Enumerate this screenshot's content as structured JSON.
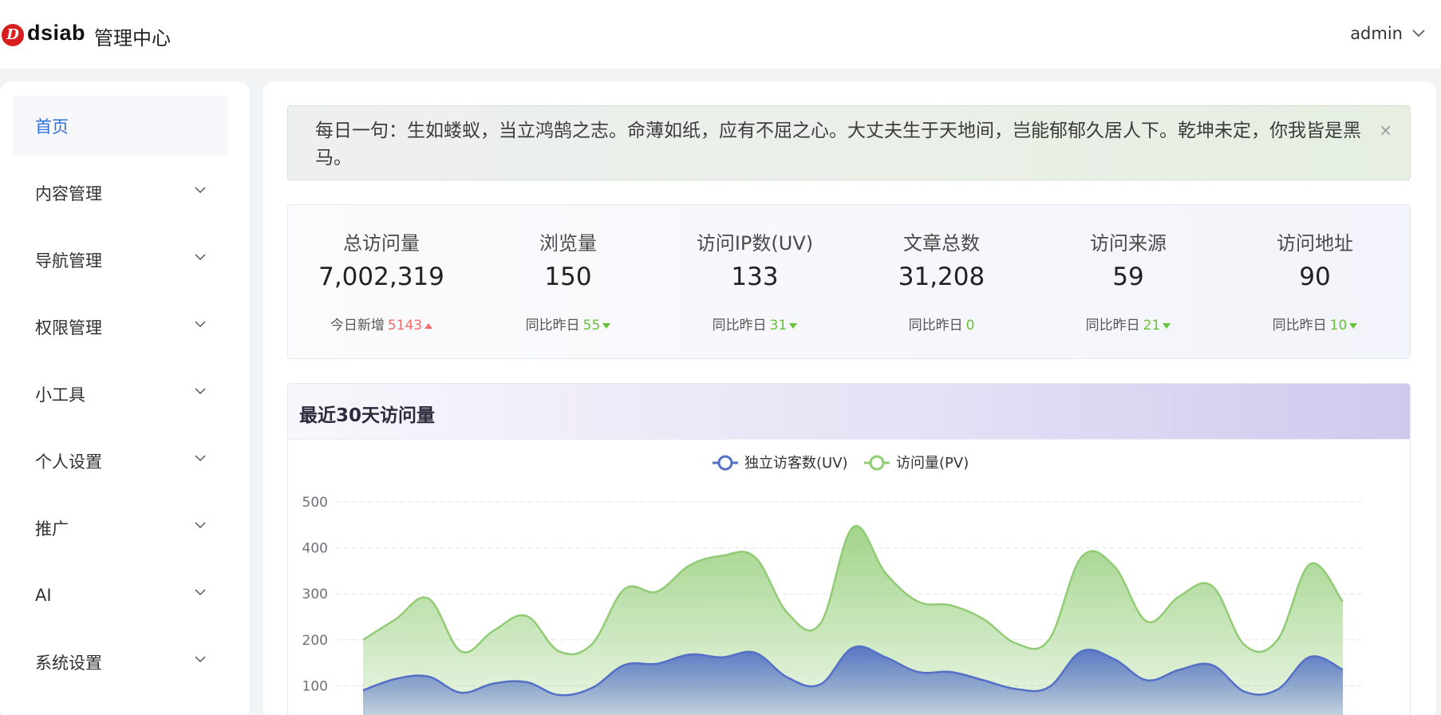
{
  "header": {
    "logo_letter": "D",
    "logo_text": "dsiab",
    "subtitle": "管理中心",
    "user": "admin"
  },
  "sidebar": {
    "items": [
      {
        "label": "首页",
        "active": true
      },
      {
        "label": "内容管理"
      },
      {
        "label": "导航管理"
      },
      {
        "label": "权限管理"
      },
      {
        "label": "小工具"
      },
      {
        "label": "个人设置"
      },
      {
        "label": "推广"
      },
      {
        "label": "AI"
      },
      {
        "label": "系统设置"
      }
    ]
  },
  "notice": {
    "text": "每日一句：生如蝼蚁，当立鸿鹄之志。命薄如纸，应有不屈之心。大丈夫生于天地间，岂能郁郁久居人下。乾坤未定，你我皆是黑马。",
    "close": "×"
  },
  "stats": [
    {
      "title": "总访问量",
      "value": "7,002,319",
      "sub_label": "今日新增",
      "sub_value": "5143",
      "trend": "up"
    },
    {
      "title": "浏览量",
      "value": "150",
      "sub_label": "同比昨日",
      "sub_value": "55",
      "trend": "down"
    },
    {
      "title": "访问IP数(UV)",
      "value": "133",
      "sub_label": "同比昨日",
      "sub_value": "31",
      "trend": "down"
    },
    {
      "title": "文章总数",
      "value": "31,208",
      "sub_label": "同比昨日",
      "sub_value": "0",
      "trend": "none"
    },
    {
      "title": "访问来源",
      "value": "59",
      "sub_label": "同比昨日",
      "sub_value": "21",
      "trend": "down"
    },
    {
      "title": "访问地址",
      "value": "90",
      "sub_label": "同比昨日",
      "sub_value": "10",
      "trend": "down"
    }
  ],
  "colors": {
    "uv": "#5470c6",
    "pv": "#91cc75",
    "up": "#f56c6c",
    "down": "#67c23a",
    "active": "#2f6fd8"
  },
  "chart_data": {
    "type": "area",
    "title": "最近30天访问量",
    "ylim": [
      0,
      500
    ],
    "yticks": [
      "0",
      "100",
      "200",
      "300",
      "400",
      "500"
    ],
    "grid": true,
    "legend_position": "top-center",
    "series": [
      {
        "name": "独立访客数(UV)",
        "values": [
          90,
          115,
          120,
          85,
          105,
          108,
          80,
          95,
          145,
          148,
          168,
          162,
          172,
          118,
          103,
          183,
          162,
          130,
          130,
          112,
          93,
          97,
          175,
          158,
          112,
          135,
          145,
          87,
          92,
          163,
          135
        ]
      },
      {
        "name": "访问量(PV)",
        "values": [
          200,
          245,
          290,
          175,
          220,
          252,
          175,
          190,
          310,
          305,
          362,
          383,
          380,
          258,
          235,
          445,
          345,
          283,
          275,
          245,
          192,
          200,
          380,
          360,
          240,
          295,
          317,
          188,
          200,
          365,
          283
        ]
      }
    ]
  }
}
